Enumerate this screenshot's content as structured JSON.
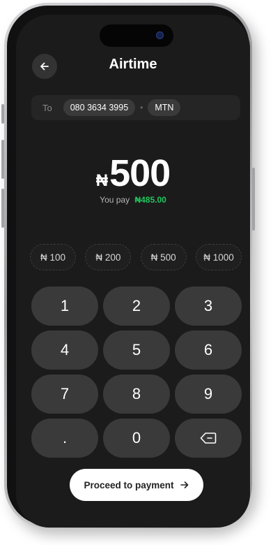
{
  "header": {
    "title": "Airtime",
    "back_icon": "arrow-left-icon"
  },
  "recipient": {
    "to_label": "To",
    "phone": "080 3634 3995",
    "separator": "•",
    "network": "MTN"
  },
  "amount": {
    "currency_symbol": "₦",
    "value": "500",
    "you_pay_label": "You pay",
    "you_pay_value": "₦485.00"
  },
  "quick_amounts": [
    "₦ 100",
    "₦ 200",
    "₦ 500",
    "₦ 1000"
  ],
  "keypad": [
    "1",
    "2",
    "3",
    "4",
    "5",
    "6",
    "7",
    "8",
    "9",
    ".",
    "0"
  ],
  "keypad_backspace_icon": "backspace-icon",
  "proceed": {
    "label": "Proceed to payment",
    "icon": "arrow-right-icon"
  },
  "colors": {
    "screen_bg": "#1b1b1b",
    "key_bg": "#3a3a3a",
    "accent_green": "#22c55e",
    "button_bg": "#ffffff"
  }
}
